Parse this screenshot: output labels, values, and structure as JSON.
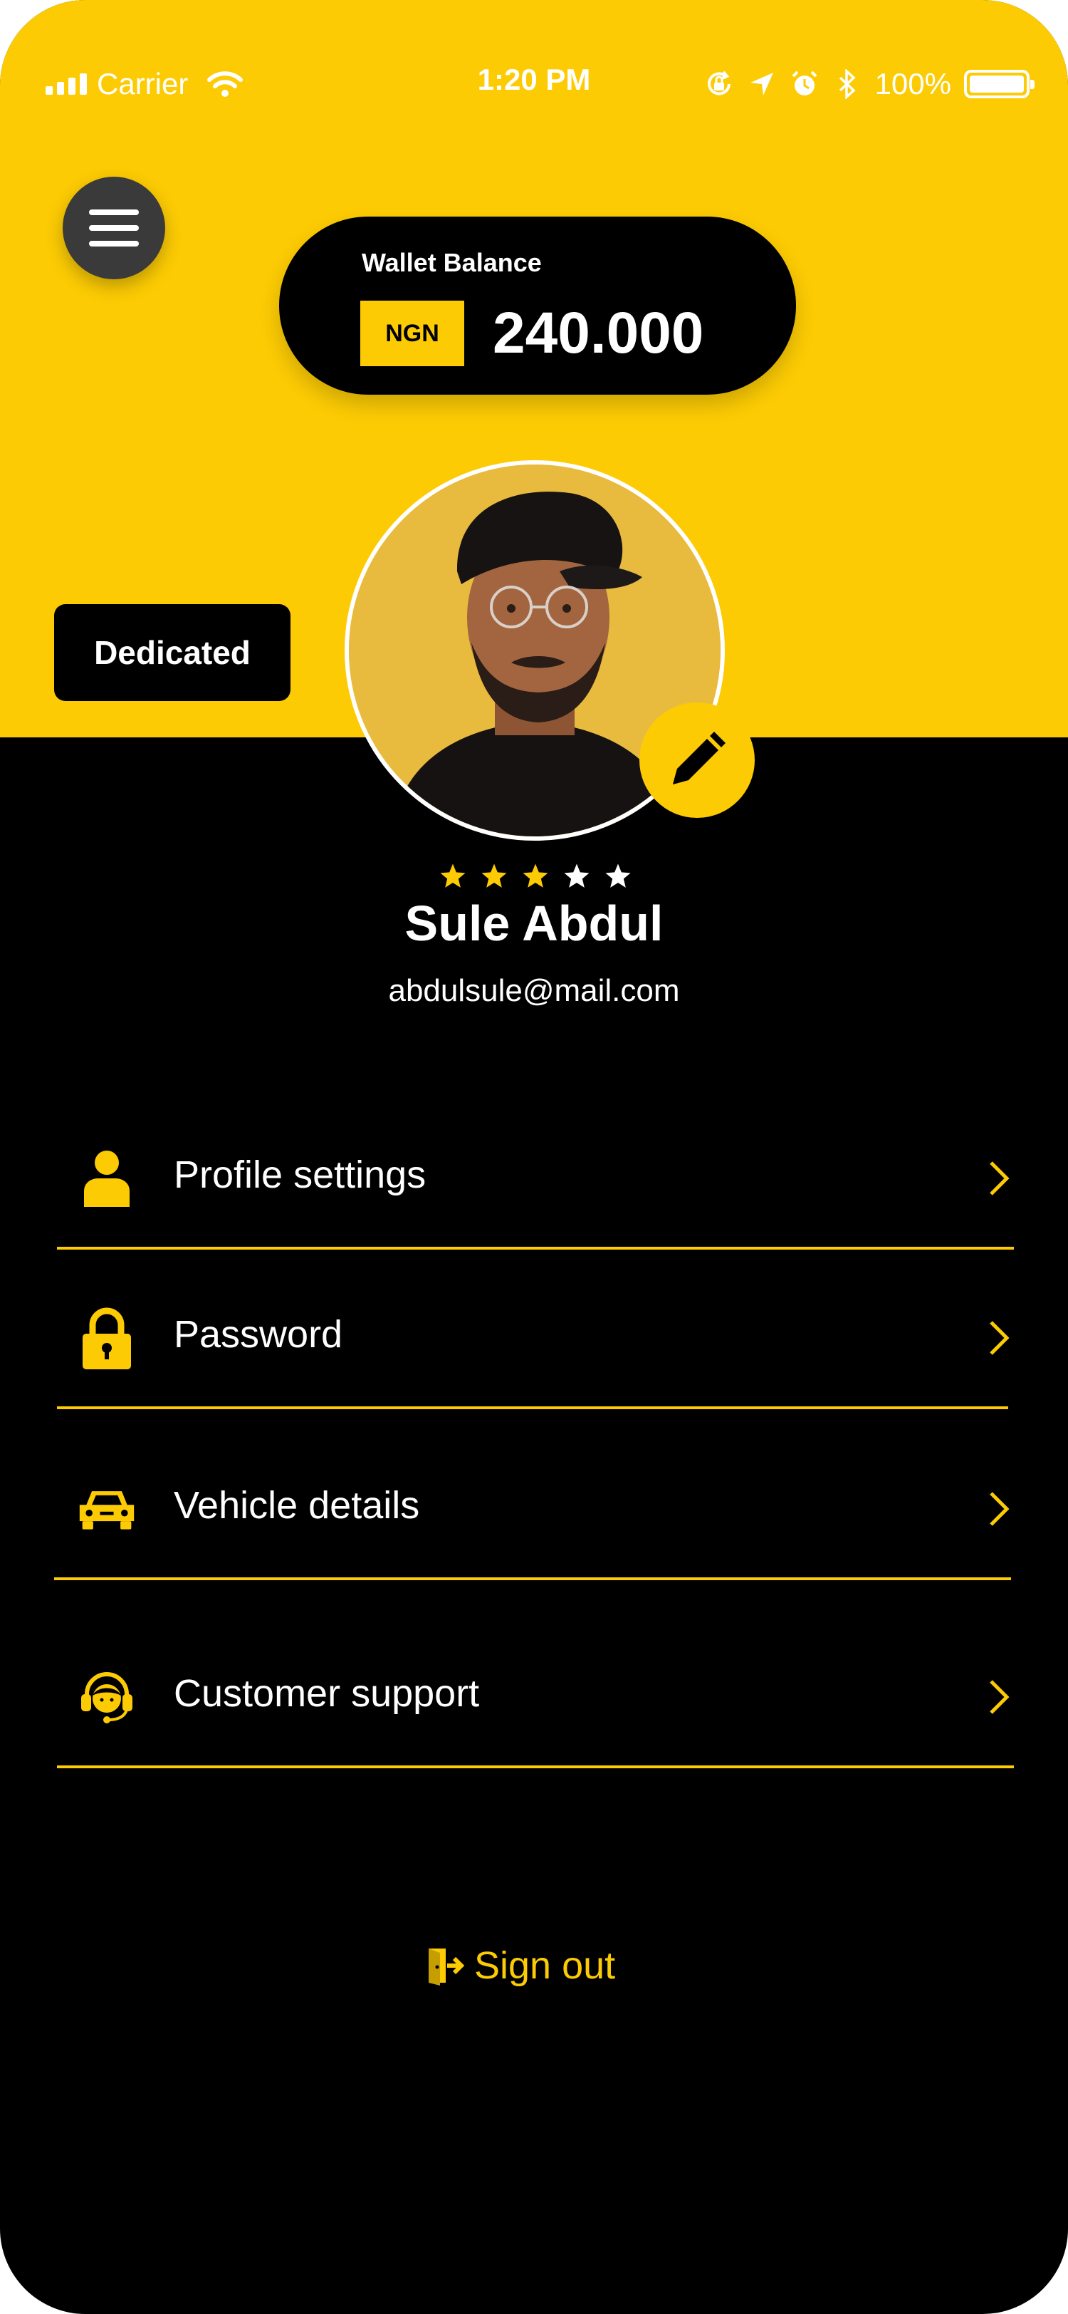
{
  "status_bar": {
    "carrier": "Carrier",
    "time": "1:20 PM",
    "battery_percent": "100%",
    "icons": [
      "signal-icon",
      "wifi-icon",
      "orientation-lock-icon",
      "location-icon",
      "alarm-icon",
      "bluetooth-icon",
      "battery-icon"
    ]
  },
  "wallet": {
    "label": "Wallet Balance",
    "currency": "NGN",
    "amount": "240.000"
  },
  "driver_badge": "Dedicated",
  "profile": {
    "name": "Sule Abdul",
    "email": "abdulsule@mail.com",
    "rating": 3,
    "rating_max": 5
  },
  "menu": {
    "items": [
      {
        "label": "Profile settings",
        "icon": "user-icon"
      },
      {
        "label": "Password",
        "icon": "lock-icon"
      },
      {
        "label": "Vehicle details",
        "icon": "car-icon"
      },
      {
        "label": "Customer support",
        "icon": "headset-icon"
      }
    ]
  },
  "sign_out": {
    "label": "Sign out",
    "icon": "exit-door-icon"
  },
  "colors": {
    "accent": "#FCCB04",
    "background": "#000000",
    "text": "#FFFFFF",
    "star_filled": "#FCCB04",
    "star_empty": "#FFFFFF"
  }
}
